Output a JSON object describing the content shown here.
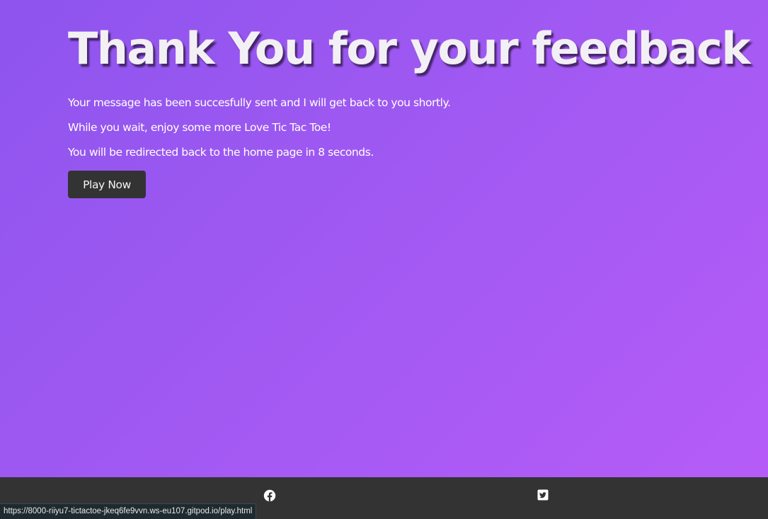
{
  "heading": "Thank You for your feedback",
  "messages": {
    "sent": "Your message has been succesfully sent and I will get back to you shortly.",
    "enjoy": "While you wait, enjoy some more Love Tic Tac Toe!",
    "redirect": "You will be redirected back to the home page in 8 seconds."
  },
  "play_button": {
    "label": "Play Now"
  },
  "footer": {
    "social": [
      {
        "icon": "facebook-icon"
      },
      {
        "icon": "twitter-icon"
      }
    ]
  },
  "status_bar": {
    "url": "https://8000-riiyu7-tictactoe-jkeq6fe9vvn.ws-eu107.gitpod.io/play.html"
  },
  "colors": {
    "gradient_start": "#8e54ee",
    "gradient_end": "#b75cf8",
    "button_bg": "#333333",
    "footer_bg": "#333333",
    "text": "#ffffff"
  }
}
